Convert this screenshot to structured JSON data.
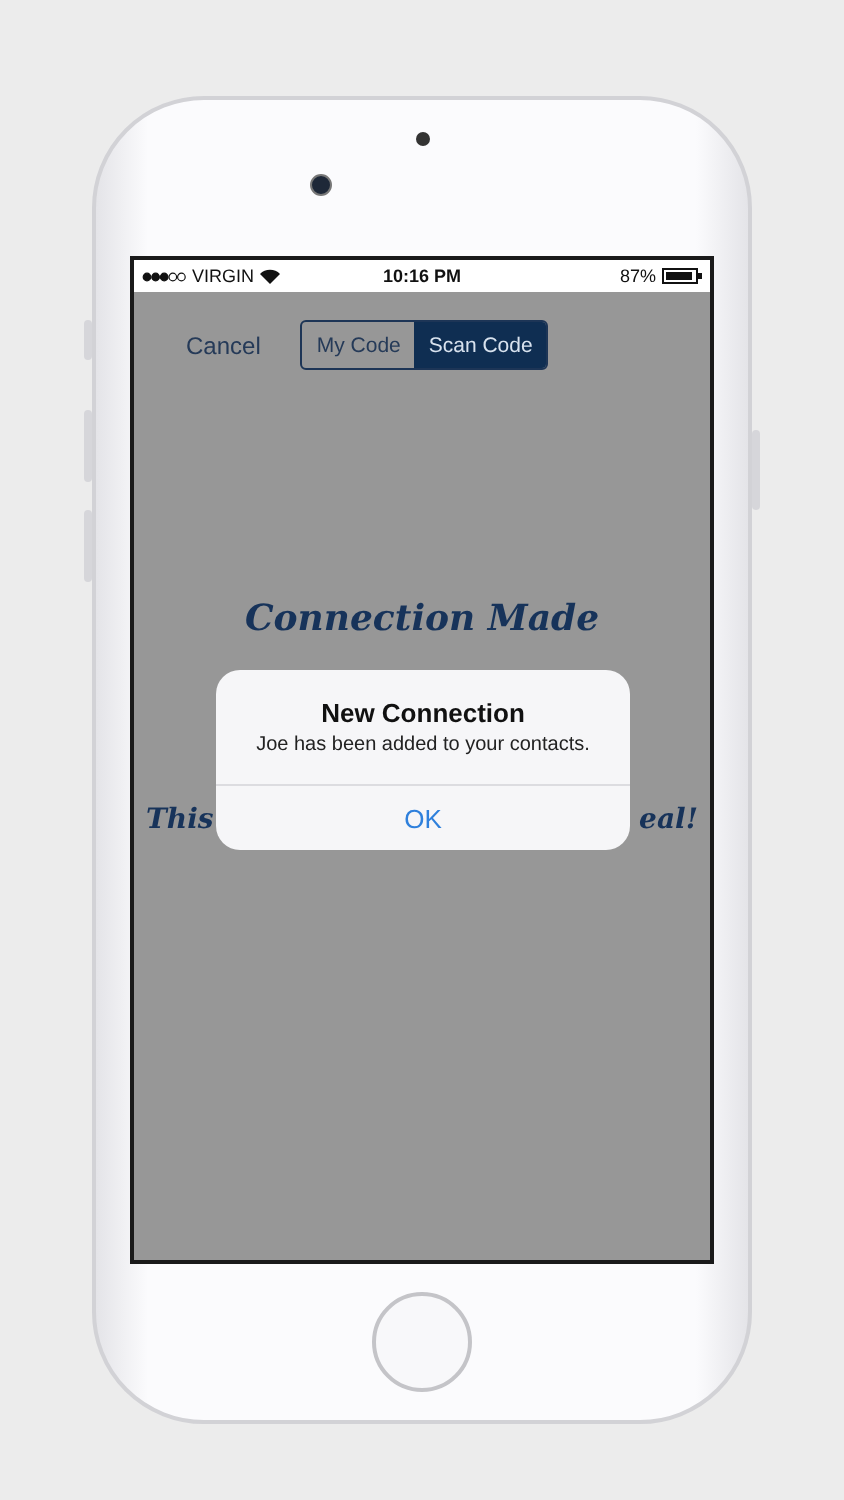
{
  "status_bar": {
    "carrier": "VIRGIN",
    "time": "10:16 PM",
    "battery": "87%"
  },
  "nav": {
    "cancel": "Cancel",
    "segments": [
      {
        "label": "My Code",
        "selected": false
      },
      {
        "label": "Scan Code",
        "selected": true
      }
    ]
  },
  "heading": "Connection Made",
  "message_fragments": [
    "This",
    "eal!"
  ],
  "alert": {
    "title": "New Connection",
    "message": "Joe has been added to your contacts.",
    "buttons": [
      "OK"
    ]
  }
}
